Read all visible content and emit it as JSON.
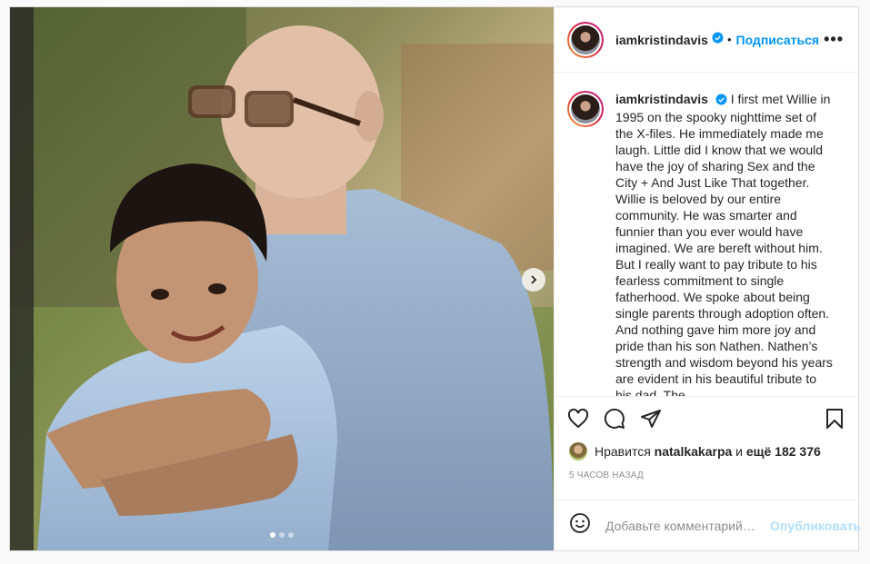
{
  "post": {
    "username": "iamkristindavis",
    "separator": "•",
    "follow_label": "Подписаться",
    "more_label": "•••",
    "caption": "I first met Willie in 1995 on the spooky nighttime set of the X-files. He immediately made me laugh. Little did I know that we would have the joy of sharing Sex and the City + And Just Like That together. Willie is beloved by our entire community. He was smarter and funnier than you ever would have imagined. We are bereft without him. But I really want to pay tribute to his fearless commitment to single fatherhood. We spoke about being single parents through adoption often. And nothing gave him more joy and pride than his son Nathen. Nathen’s strength and wisdom beyond his years are evident in his beautiful tribute to his dad. The",
    "likes": {
      "prefix": "Нравится",
      "user": "natalkakarpa",
      "middle": "и",
      "count": "ещё 182 376"
    },
    "time": "5 ЧАСОВ НАЗАД",
    "comment_placeholder": "Добавьте комментарий…",
    "publish_label": "Опубликовать",
    "carousel": {
      "total": 3,
      "active": 0
    }
  },
  "icons": {
    "verified": "verified-badge-icon",
    "like": "heart-icon",
    "comment": "comment-icon",
    "share": "paper-plane-icon",
    "save": "bookmark-icon",
    "emoji": "smiley-icon",
    "next": "chevron-right-icon"
  },
  "colors": {
    "accent": "#0095f6",
    "publish_disabled": "#b2dffc",
    "muted": "#8e8e8e"
  }
}
